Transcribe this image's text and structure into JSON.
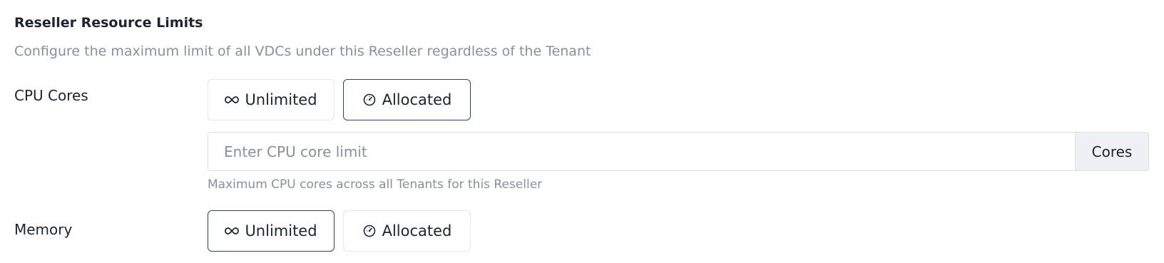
{
  "section": {
    "title": "Reseller Resource Limits",
    "description": "Configure the maximum limit of all VDCs under this Reseller regardless of the Tenant"
  },
  "cpu": {
    "label": "CPU Cores",
    "options": [
      {
        "label": "Unlimited",
        "icon": "infinity-icon",
        "selected": false
      },
      {
        "label": "Allocated",
        "icon": "gauge-icon",
        "selected": true
      }
    ],
    "input": {
      "value": "",
      "placeholder": "Enter CPU core limit",
      "suffix": "Cores"
    },
    "help": "Maximum CPU cores across all Tenants for this Reseller"
  },
  "memory": {
    "label": "Memory",
    "options": [
      {
        "label": "Unlimited",
        "icon": "infinity-icon",
        "selected": true
      },
      {
        "label": "Allocated",
        "icon": "gauge-icon",
        "selected": false
      }
    ]
  },
  "colors": {
    "selected_border": "#34426b",
    "muted_text": "#8a8f9b",
    "addon_background": "#eef0f3"
  }
}
